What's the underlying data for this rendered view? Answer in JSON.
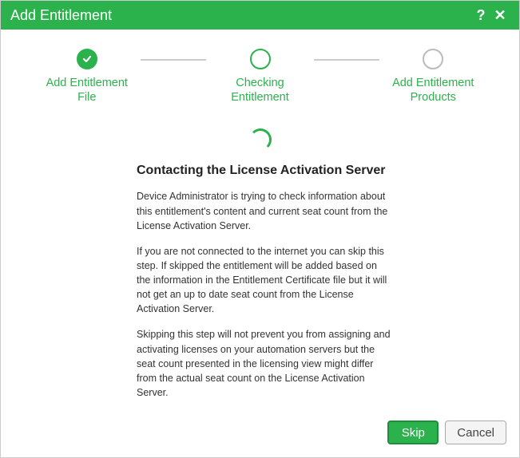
{
  "titlebar": {
    "title": "Add Entitlement",
    "help": "?",
    "close": "✕"
  },
  "steps": {
    "s1": {
      "label": "Add Entitlement\nFile"
    },
    "s2": {
      "label": "Checking\nEntitlement"
    },
    "s3": {
      "label": "Add Entitlement\nProducts"
    }
  },
  "content": {
    "heading": "Contacting the License Activation Server",
    "p1": "Device Administrator is trying to check information about this entitlement's content and current seat count from the License Activation Server.",
    "p2": "If you are not connected to the internet you can skip this step. If skipped the entitlement will be added based on the information in the Entitlement Certificate file but it will not get an up to date seat count from the License Activation Server.",
    "p3": "Skipping this step will not prevent you from assigning and activating licenses on your automation servers but the seat count presented in the licensing view might differ from the actual seat count on the License Activation Server."
  },
  "footer": {
    "skip": "Skip",
    "cancel": "Cancel"
  }
}
